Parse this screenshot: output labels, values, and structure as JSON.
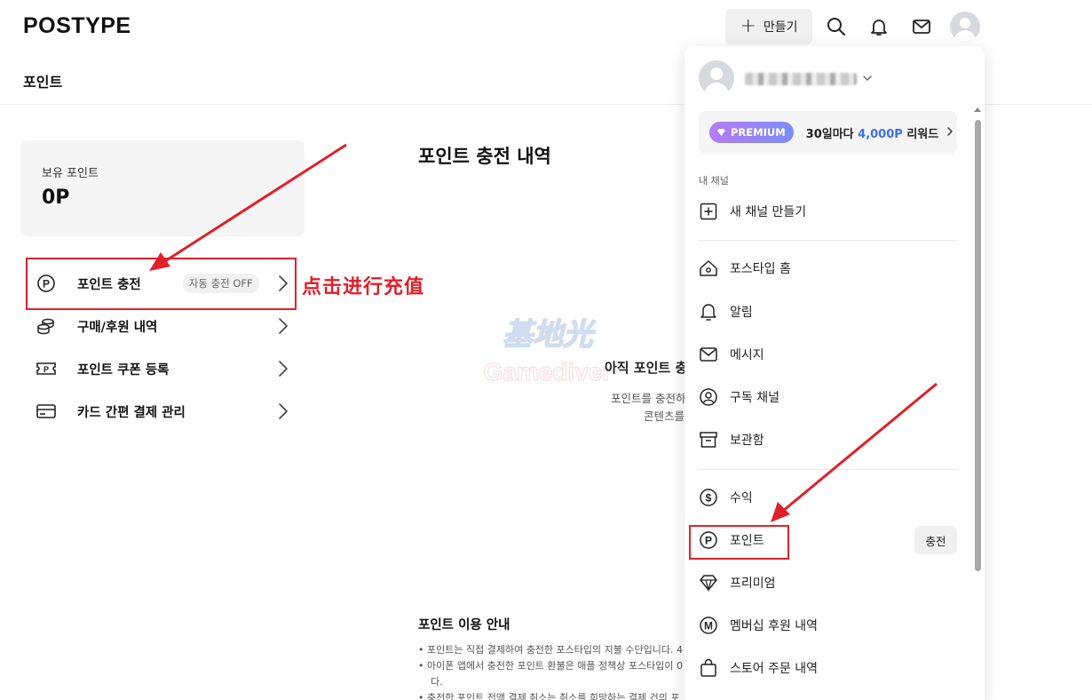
{
  "header": {
    "logo": "POSTYPE",
    "create_label": "만들기",
    "page_title": "포인트"
  },
  "sidebar": {
    "balance_label": "보유 포인트",
    "balance_value": "0P",
    "items": [
      {
        "label": "포인트 충전",
        "badge": "자동 충전 OFF",
        "icon": "point-p-icon"
      },
      {
        "label": "구매/후원 내역",
        "icon": "coins-icon"
      },
      {
        "label": "포인트 쿠폰 등록",
        "icon": "coupon-icon"
      },
      {
        "label": "카드 간편 결제 관리",
        "icon": "card-icon"
      }
    ]
  },
  "annotation": {
    "text": "点击进行充值",
    "color": "#e0202a"
  },
  "main": {
    "title": "포인트 충전 내역",
    "empty_title": "아직 포인트 충",
    "empty_lines": [
      "포인트를 충전하",
      "콘텐츠를"
    ],
    "guide_title": "포인트 이용 안내",
    "guide_items": [
      "포인트는 직접 결제하여 충전한 포스타입의 지불 수단입니다. 4",
      "아이폰 앱에서 충전한 포인트 환불은 애플 정책상 포스타입이 0",
      "다.",
      "충전한 포인트 전액 결제 취소는 취소를 희망하는 결제 건의 포"
    ]
  },
  "dropdown": {
    "premium_badge": "PREMIUM",
    "premium_text_prefix": "30일마다 ",
    "premium_text_accent": "4,000P",
    "premium_text_suffix": " 리워드",
    "section_label": "내 채널",
    "new_channel": "새 채널 만들기",
    "items_group1": [
      {
        "label": "포스타입 홈",
        "icon": "home-icon"
      },
      {
        "label": "알림",
        "icon": "bell-icon"
      },
      {
        "label": "메시지",
        "icon": "mail-icon"
      },
      {
        "label": "구독 채널",
        "icon": "subscribed-channel-icon"
      },
      {
        "label": "보관함",
        "icon": "archive-icon"
      }
    ],
    "items_group2": [
      {
        "label": "수익",
        "icon": "dollar-icon"
      },
      {
        "label": "포인트",
        "icon": "point-p-icon",
        "action": "충전"
      },
      {
        "label": "프리미엄",
        "icon": "diamond-icon"
      },
      {
        "label": "멤버십 후원 내역",
        "icon": "membership-m-icon"
      },
      {
        "label": "스토어 주문 내역",
        "icon": "shopping-bag-icon"
      }
    ]
  },
  "colors": {
    "accent_blue": "#3d6ff2",
    "annotation_red": "#e0202a"
  }
}
